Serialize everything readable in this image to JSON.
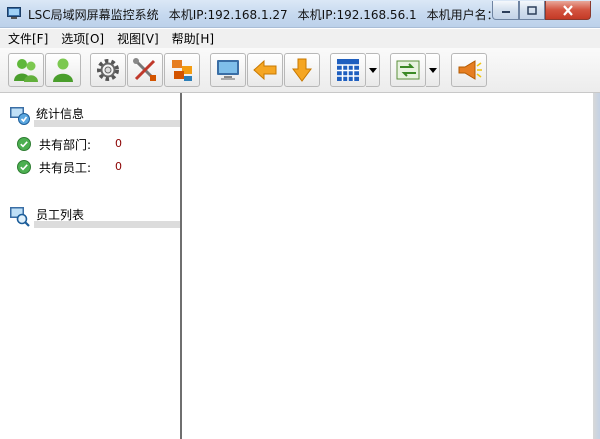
{
  "window": {
    "title_parts": [
      "LSC局域网屏幕监控系统",
      "本机IP:192.168.1.27",
      "本机IP:192.168.56.1",
      "本机用户名：HY..."
    ]
  },
  "menu": [
    "文件[F]",
    "选项[O]",
    "视图[V]",
    "帮助[H]"
  ],
  "toolbar": [
    {
      "name": "user-add-icon"
    },
    {
      "name": "user-icon"
    },
    {
      "name": "gear-icon"
    },
    {
      "name": "tools-icon"
    },
    {
      "name": "network-icon"
    },
    {
      "name": "monitor-icon"
    },
    {
      "name": "arrow-left-icon"
    },
    {
      "name": "arrow-down-icon"
    },
    {
      "name": "grid-icon"
    },
    {
      "name": "transfer-icon"
    },
    {
      "name": "broadcast-icon"
    }
  ],
  "left_panel": {
    "stats_title": "统计信息",
    "stats": [
      {
        "label": "共有部门:",
        "value": "0"
      },
      {
        "label": "共有员工:",
        "value": "0"
      }
    ],
    "employees_title": "员工列表"
  },
  "colors": {
    "accent": "#c6d9ef",
    "value_red": "#8b0000"
  }
}
